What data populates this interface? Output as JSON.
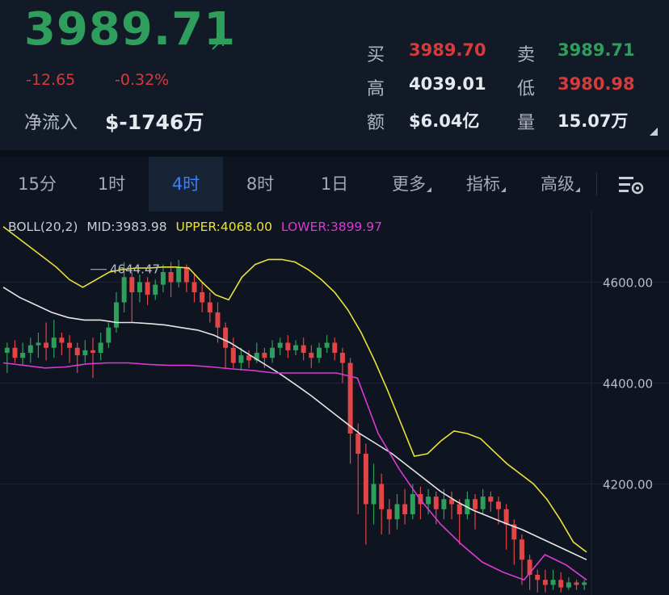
{
  "quote": {
    "price": "3989.71",
    "change": "-12.65",
    "change_pct": "-0.32%",
    "netflow_label": "净流入",
    "netflow_value": "$-1746万",
    "bid_label": "买",
    "bid": "3989.70",
    "ask_label": "卖",
    "ask": "3989.71",
    "high_label": "高",
    "high": "4039.01",
    "low_label": "低",
    "low": "3980.98",
    "amount_label": "额",
    "amount": "$6.04亿",
    "volume_label": "量",
    "volume": "15.07万",
    "icons": {
      "trend": "arrow-up-right-icon",
      "collapse": "chevron-down-icon"
    }
  },
  "tabs": [
    {
      "label": "15分",
      "active": false
    },
    {
      "label": "1时",
      "active": false
    },
    {
      "label": "4时",
      "active": true
    },
    {
      "label": "8时",
      "active": false
    },
    {
      "label": "1日",
      "active": false
    },
    {
      "label": "更多",
      "active": false,
      "dropdown": true
    },
    {
      "label": "指标",
      "active": false,
      "dropdown": true
    },
    {
      "label": "高级",
      "active": false,
      "dropdown": true
    }
  ],
  "toolbar": {
    "settings_icon": "chart-settings-icon"
  },
  "indicator": {
    "name": "BOLL(20,2)",
    "mid": "MID:3983.98",
    "upper": "UPPER:4068.00",
    "lower": "LOWER:3899.97"
  },
  "colors": {
    "up": "#2f9d5c",
    "down": "#e24545",
    "upper": "#e9e23a",
    "mid": "#e6e6e6",
    "lower": "#d93ad6",
    "accent": "#3d7ff5"
  },
  "chart_data": {
    "type": "candlestick",
    "y_ticks": [
      "4600.00",
      "4400.00",
      "4200.00"
    ],
    "y_tick_values": [
      4600,
      4400,
      4200
    ],
    "ylim": [
      3980,
      4740
    ],
    "max_label": "4644.47",
    "max_value": 4644.47,
    "candles": [
      [
        4460,
        4470,
        4420,
        4480
      ],
      [
        4470,
        4450,
        4440,
        4485
      ],
      [
        4450,
        4460,
        4435,
        4480
      ],
      [
        4460,
        4475,
        4440,
        4490
      ],
      [
        4475,
        4480,
        4450,
        4500
      ],
      [
        4480,
        4470,
        4445,
        4520
      ],
      [
        4470,
        4490,
        4450,
        4525
      ],
      [
        4490,
        4480,
        4455,
        4500
      ],
      [
        4480,
        4470,
        4440,
        4495
      ],
      [
        4470,
        4455,
        4420,
        4480
      ],
      [
        4455,
        4465,
        4440,
        4485
      ],
      [
        4465,
        4460,
        4410,
        4490
      ],
      [
        4460,
        4480,
        4445,
        4500
      ],
      [
        4480,
        4510,
        4470,
        4520
      ],
      [
        4510,
        4560,
        4500,
        4580
      ],
      [
        4560,
        4610,
        4540,
        4640
      ],
      [
        4610,
        4580,
        4520,
        4620
      ],
      [
        4580,
        4600,
        4560,
        4615
      ],
      [
        4600,
        4575,
        4555,
        4610
      ],
      [
        4575,
        4595,
        4565,
        4605
      ],
      [
        4595,
        4620,
        4580,
        4635
      ],
      [
        4620,
        4600,
        4570,
        4640
      ],
      [
        4600,
        4630,
        4590,
        4644
      ],
      [
        4630,
        4600,
        4580,
        4635
      ],
      [
        4600,
        4580,
        4560,
        4615
      ],
      [
        4580,
        4560,
        4540,
        4600
      ],
      [
        4560,
        4540,
        4520,
        4580
      ],
      [
        4540,
        4510,
        4480,
        4560
      ],
      [
        4510,
        4470,
        4430,
        4520
      ],
      [
        4470,
        4440,
        4430,
        4490
      ],
      [
        4440,
        4455,
        4425,
        4470
      ],
      [
        4455,
        4445,
        4430,
        4465
      ],
      [
        4445,
        4460,
        4440,
        4480
      ],
      [
        4460,
        4450,
        4430,
        4470
      ],
      [
        4450,
        4470,
        4440,
        4485
      ],
      [
        4470,
        4480,
        4455,
        4490
      ],
      [
        4480,
        4465,
        4450,
        4495
      ],
      [
        4465,
        4475,
        4455,
        4485
      ],
      [
        4475,
        4460,
        4445,
        4490
      ],
      [
        4460,
        4450,
        4430,
        4475
      ],
      [
        4450,
        4470,
        4440,
        4480
      ],
      [
        4470,
        4480,
        4460,
        4495
      ],
      [
        4480,
        4460,
        4445,
        4490
      ],
      [
        4460,
        4440,
        4400,
        4470
      ],
      [
        4440,
        4300,
        4240,
        4450
      ],
      [
        4300,
        4260,
        4140,
        4320
      ],
      [
        4260,
        4160,
        4080,
        4280
      ],
      [
        4160,
        4200,
        4120,
        4240
      ],
      [
        4200,
        4150,
        4100,
        4220
      ],
      [
        4150,
        4130,
        4100,
        4170
      ],
      [
        4130,
        4160,
        4110,
        4180
      ],
      [
        4160,
        4140,
        4120,
        4190
      ],
      [
        4140,
        4180,
        4130,
        4200
      ],
      [
        4180,
        4160,
        4130,
        4195
      ],
      [
        4160,
        4175,
        4140,
        4190
      ],
      [
        4175,
        4150,
        4120,
        4185
      ],
      [
        4150,
        4170,
        4130,
        4190
      ],
      [
        4170,
        4160,
        4130,
        4185
      ],
      [
        4160,
        4140,
        4080,
        4170
      ],
      [
        4140,
        4170,
        4130,
        4185
      ],
      [
        4170,
        4150,
        4110,
        4180
      ],
      [
        4150,
        4175,
        4140,
        4190
      ],
      [
        4175,
        4165,
        4145,
        4185
      ],
      [
        4165,
        4150,
        4120,
        4175
      ],
      [
        4150,
        4120,
        4070,
        4160
      ],
      [
        4120,
        4090,
        4040,
        4130
      ],
      [
        4090,
        4050,
        4000,
        4100
      ],
      [
        4050,
        4020,
        3990,
        4060
      ],
      [
        4020,
        4010,
        3985,
        4030
      ],
      [
        4010,
        4000,
        3985,
        4030
      ],
      [
        4000,
        4010,
        3990,
        4030
      ],
      [
        4010,
        3995,
        3985,
        4025
      ],
      [
        3995,
        4005,
        3990,
        4015
      ],
      [
        4005,
        4000,
        3990,
        4010
      ],
      [
        4000,
        4005,
        3990,
        4010
      ]
    ],
    "upper": [
      4710,
      4690,
      4670,
      4650,
      4630,
      4605,
      4590,
      4605,
      4620,
      4625,
      4628,
      4628,
      4630,
      4630,
      4628,
      4600,
      4575,
      4565,
      4610,
      4635,
      4645,
      4645,
      4640,
      4625,
      4605,
      4580,
      4545,
      4500,
      4445,
      4385,
      4320,
      4255,
      4260,
      4285,
      4305,
      4300,
      4290,
      4265,
      4240,
      4220,
      4200,
      4170,
      4130,
      4085,
      4065
    ],
    "mid": [
      4590,
      4570,
      4555,
      4540,
      4530,
      4525,
      4525,
      4520,
      4520,
      4518,
      4515,
      4510,
      4505,
      4495,
      4480,
      4460,
      4440,
      4420,
      4398,
      4375,
      4350,
      4325,
      4300,
      4280,
      4260,
      4235,
      4210,
      4185,
      4165,
      4148,
      4135,
      4122,
      4110,
      4095,
      4080,
      4065,
      4050
    ],
    "lower": [
      4440,
      4435,
      4430,
      4432,
      4438,
      4440,
      4440,
      4437,
      4435,
      4435,
      4432,
      4428,
      4425,
      4420,
      4420,
      4420,
      4420,
      4410,
      4300,
      4230,
      4170,
      4120,
      4080,
      4045,
      4025,
      4010,
      4060,
      4040,
      4010
    ]
  }
}
